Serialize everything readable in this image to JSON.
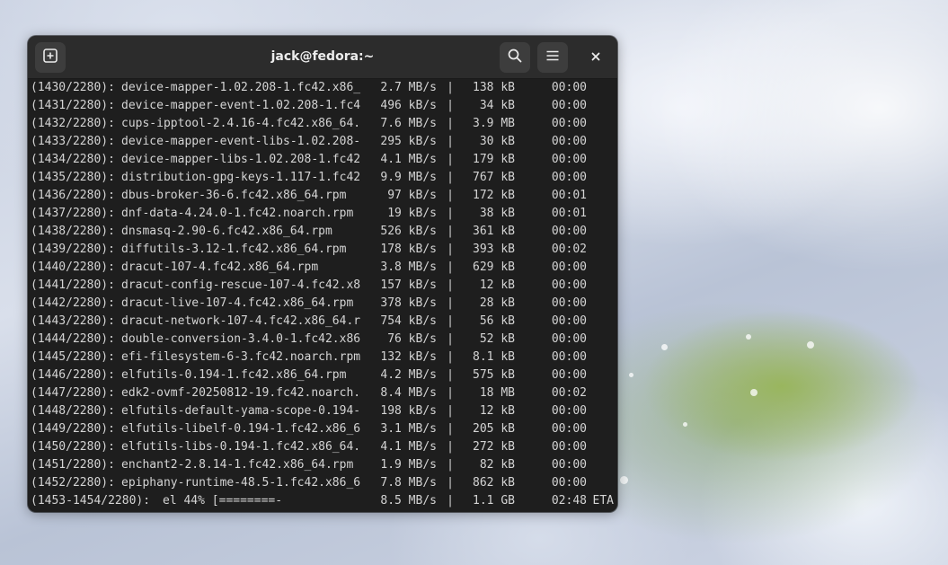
{
  "window": {
    "title": "jack@fedora:~",
    "icons": {
      "new_tab": "new-tab-icon",
      "search": "search-icon",
      "menu": "hamburger-menu-icon",
      "close": "close-icon"
    }
  },
  "terminal": {
    "rows": [
      {
        "id": "(1430/2280):",
        "name": "device-mapper-1.02.208-1.fc42.x86_",
        "rate": "2.7 MB/s",
        "size": "138 kB",
        "time": "00:00"
      },
      {
        "id": "(1431/2280):",
        "name": "device-mapper-event-1.02.208-1.fc4",
        "rate": "496 kB/s",
        "size": "34 kB",
        "time": "00:00"
      },
      {
        "id": "(1432/2280):",
        "name": "cups-ipptool-2.4.16-4.fc42.x86_64.",
        "rate": "7.6 MB/s",
        "size": "3.9 MB",
        "time": "00:00"
      },
      {
        "id": "(1433/2280):",
        "name": "device-mapper-event-libs-1.02.208-",
        "rate": "295 kB/s",
        "size": "30 kB",
        "time": "00:00"
      },
      {
        "id": "(1434/2280):",
        "name": "device-mapper-libs-1.02.208-1.fc42",
        "rate": "4.1 MB/s",
        "size": "179 kB",
        "time": "00:00"
      },
      {
        "id": "(1435/2280):",
        "name": "distribution-gpg-keys-1.117-1.fc42",
        "rate": "9.9 MB/s",
        "size": "767 kB",
        "time": "00:00"
      },
      {
        "id": "(1436/2280):",
        "name": "dbus-broker-36-6.fc42.x86_64.rpm",
        "rate": "97 kB/s",
        "size": "172 kB",
        "time": "00:01"
      },
      {
        "id": "(1437/2280):",
        "name": "dnf-data-4.24.0-1.fc42.noarch.rpm",
        "rate": "19 kB/s",
        "size": "38 kB",
        "time": "00:01"
      },
      {
        "id": "(1438/2280):",
        "name": "dnsmasq-2.90-6.fc42.x86_64.rpm",
        "rate": "526 kB/s",
        "size": "361 kB",
        "time": "00:00"
      },
      {
        "id": "(1439/2280):",
        "name": "diffutils-3.12-1.fc42.x86_64.rpm",
        "rate": "178 kB/s",
        "size": "393 kB",
        "time": "00:02"
      },
      {
        "id": "(1440/2280):",
        "name": "dracut-107-4.fc42.x86_64.rpm",
        "rate": "3.8 MB/s",
        "size": "629 kB",
        "time": "00:00"
      },
      {
        "id": "(1441/2280):",
        "name": "dracut-config-rescue-107-4.fc42.x8",
        "rate": "157 kB/s",
        "size": "12 kB",
        "time": "00:00"
      },
      {
        "id": "(1442/2280):",
        "name": "dracut-live-107-4.fc42.x86_64.rpm",
        "rate": "378 kB/s",
        "size": "28 kB",
        "time": "00:00"
      },
      {
        "id": "(1443/2280):",
        "name": "dracut-network-107-4.fc42.x86_64.r",
        "rate": "754 kB/s",
        "size": "56 kB",
        "time": "00:00"
      },
      {
        "id": "(1444/2280):",
        "name": "double-conversion-3.4.0-1.fc42.x86",
        "rate": "76 kB/s",
        "size": "52 kB",
        "time": "00:00"
      },
      {
        "id": "(1445/2280):",
        "name": "efi-filesystem-6-3.fc42.noarch.rpm",
        "rate": "132 kB/s",
        "size": "8.1 kB",
        "time": "00:00"
      },
      {
        "id": "(1446/2280):",
        "name": "elfutils-0.194-1.fc42.x86_64.rpm",
        "rate": "4.2 MB/s",
        "size": "575 kB",
        "time": "00:00"
      },
      {
        "id": "(1447/2280):",
        "name": "edk2-ovmf-20250812-19.fc42.noarch.",
        "rate": "8.4 MB/s",
        "size": "18 MB",
        "time": "00:02"
      },
      {
        "id": "(1448/2280):",
        "name": "elfutils-default-yama-scope-0.194-",
        "rate": "198 kB/s",
        "size": "12 kB",
        "time": "00:00"
      },
      {
        "id": "(1449/2280):",
        "name": "elfutils-libelf-0.194-1.fc42.x86_6",
        "rate": "3.1 MB/s",
        "size": "205 kB",
        "time": "00:00"
      },
      {
        "id": "(1450/2280):",
        "name": "elfutils-libs-0.194-1.fc42.x86_64.",
        "rate": "4.1 MB/s",
        "size": "272 kB",
        "time": "00:00"
      },
      {
        "id": "(1451/2280):",
        "name": "enchant2-2.8.14-1.fc42.x86_64.rpm",
        "rate": "1.9 MB/s",
        "size": "82 kB",
        "time": "00:00"
      },
      {
        "id": "(1452/2280):",
        "name": "epiphany-runtime-48.5-1.fc42.x86_6",
        "rate": "7.8 MB/s",
        "size": "862 kB",
        "time": "00:00"
      }
    ],
    "progress_line": {
      "id": "(1453-1454/2280):",
      "name": "el 44% [========-            ]",
      "percent": 44,
      "rate": "8.5 MB/s",
      "size": "1.1 GB",
      "time": "02:48",
      "eta": "ETA"
    },
    "separator": "|"
  }
}
